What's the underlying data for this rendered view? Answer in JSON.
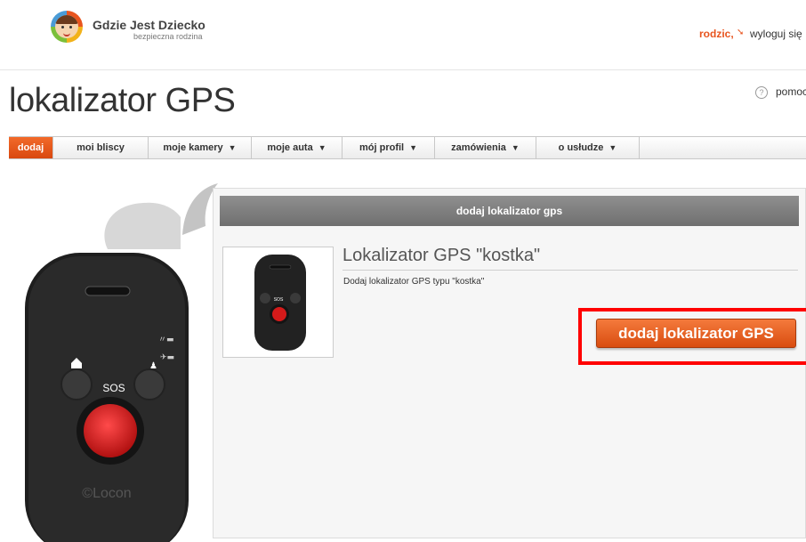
{
  "header": {
    "logo_title": "Gdzie Jest Dziecko",
    "logo_subtitle": "bezpieczna rodzina",
    "user_label": "rodzic,",
    "logout_label": "wyloguj się"
  },
  "page": {
    "title": "lokalizator GPS",
    "help_label": "pomoc",
    "help_icon_glyph": "?"
  },
  "nav": {
    "items": [
      {
        "label": "dodaj",
        "active": true,
        "dropdown": false
      },
      {
        "label": "moi bliscy",
        "active": false,
        "dropdown": false
      },
      {
        "label": "moje kamery",
        "active": false,
        "dropdown": true
      },
      {
        "label": "moje auta",
        "active": false,
        "dropdown": true
      },
      {
        "label": "mój profil",
        "active": false,
        "dropdown": true
      },
      {
        "label": "zamówienia",
        "active": false,
        "dropdown": true
      },
      {
        "label": "o usłudze",
        "active": false,
        "dropdown": true
      }
    ],
    "caret_glyph": "▼"
  },
  "device": {
    "sos_label": "SOS",
    "brand": "©Locon"
  },
  "panel": {
    "header": "dodaj lokalizator gps",
    "product_title": "Lokalizator GPS \"kostka\"",
    "product_desc": "Dodaj lokalizator GPS typu \"kostka\"",
    "add_button": "dodaj lokalizator GPS"
  },
  "colors": {
    "accent": "#e8541e",
    "highlight": "#ff0000",
    "panel_header": "#7a7a7a"
  }
}
